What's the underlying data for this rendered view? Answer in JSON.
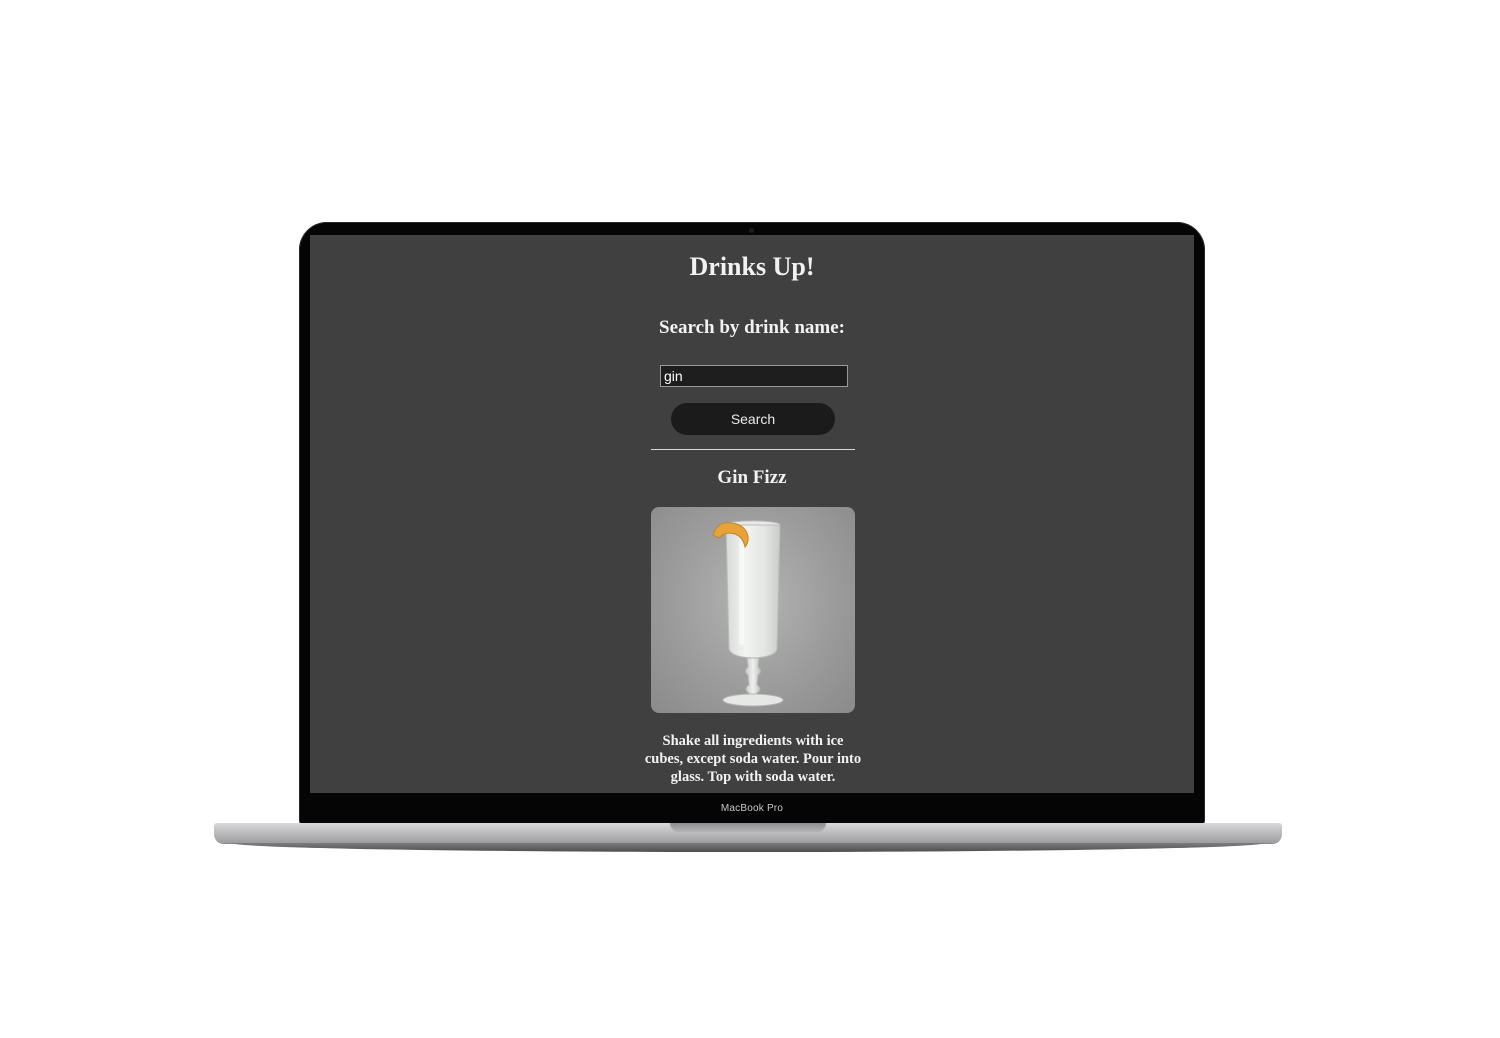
{
  "device": {
    "bezel_label": "MacBook Pro"
  },
  "app": {
    "title": "Drinks Up!",
    "search_heading": "Search by drink name:",
    "search_value": "gin",
    "search_button_label": "Search"
  },
  "result": {
    "name": "Gin Fizz",
    "image_alt": "Gin Fizz",
    "instructions": "Shake all ingredients with ice cubes, except soda water. Pour into glass. Top with soda water."
  },
  "colors": {
    "page_background": "#404040",
    "button_background": "#1b1b1b",
    "input_background": "#1e1e1e",
    "text": "#f2f2f2"
  }
}
